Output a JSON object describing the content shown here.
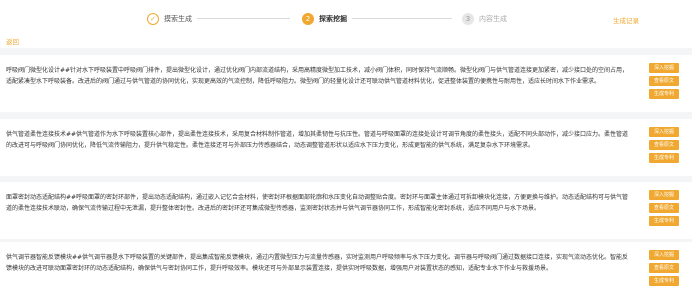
{
  "steps": [
    {
      "index": "✓",
      "label": "摸索生成",
      "state": "done"
    },
    {
      "index": "2",
      "label": "探索挖掘",
      "state": "active"
    },
    {
      "index": "3",
      "label": "内容生成",
      "state": "todo"
    }
  ],
  "header": {
    "history_label": "生成记录",
    "back_label": "返回"
  },
  "cards": [
    {
      "text": "呼吸阀门微型化设计##针对水下呼吸装置中呼吸阀门排件，提出微型化设计，通过优化阀门内部流道结构，采用高精度微型加工技术，减小阀门体积，同时保持气流顺畅。微型化阀门与供气管道连接更加紧密，减少接口处的空间占用，适配紧凑型水下呼吸装备。改进后的阀门通过与供气管道的协同优化，实现更高效的气流控制，降低呼吸阻力。微型阀门的轻量化设计还可联动供气管道材料优化，促进整体装置的便携性与耐用性，适应长时间水下作业需求。",
      "buttons": [
        "深入挖掘",
        "查看原文",
        "生成专利"
      ]
    },
    {
      "text": "供气管道柔性连接技术##供气管道作为水下呼吸装置核心部件，提出柔性连接技术，采用复合材料制作管道，增加其柔韧性与抗压性。管道与呼吸面罩的连接处设计可调节角度的柔性接头，适配不同头部动作，减少接口应力。柔性管道的改进可与呼吸阀门协同优化，降低气流传输阻力，提升供气稳定性。柔性连接还可与外部压力传感器结合，动态调整管道形状以适应水下压力变化，形成更智能的供气系统，满足复杂水下环境需求。",
      "buttons": [
        "深入挖掘",
        "查看原文",
        "生成专利"
      ]
    },
    {
      "text": "面罩密封动态适配结构##呼吸面罩的密封环部件，提出动态适配结构，通过嵌入记忆合金材料，使密封环根据面部轮廓和水压变化自动调整贴合度。密封环与面罩主体通过可拆卸模块化连接，方便更换与维护。动态适配结构可与供气管道的柔性连接技术联动，确保气流传输过程中无泄漏，提升整体密封性。改进后的密封环还可集成微型传感器，监测密封状态并与供气调节器协同工作，形成智能化密封系统，适应不同用户与水下场景。",
      "buttons": [
        "深入挖掘",
        "查看原文",
        "生成专利"
      ]
    },
    {
      "text": "供气调节器智能反馈模块##供气调节器是水下呼吸装置的关键部件，提出集成智能反馈模块，通过内置微型压力与流量传感器，实时监测用户呼吸频率与水下压力变化。调节器与呼吸阀门通过数据接口连接，实现气流动态优化。智能反馈模块的改进可联动面罩密封环的动态适配结构，确保供气与密封协同工作，提升呼吸效率。模块还可与外部显示装置连接，提供实时呼吸数据，增强用户对装置状态的感知，适配专业水下作业与救援场景。",
      "buttons": [
        "深入挖掘",
        "查看原文",
        "生成专利"
      ]
    }
  ],
  "colors": {
    "accent": "#f0a830",
    "background": "#f4f5f7",
    "card": "#ffffff"
  }
}
